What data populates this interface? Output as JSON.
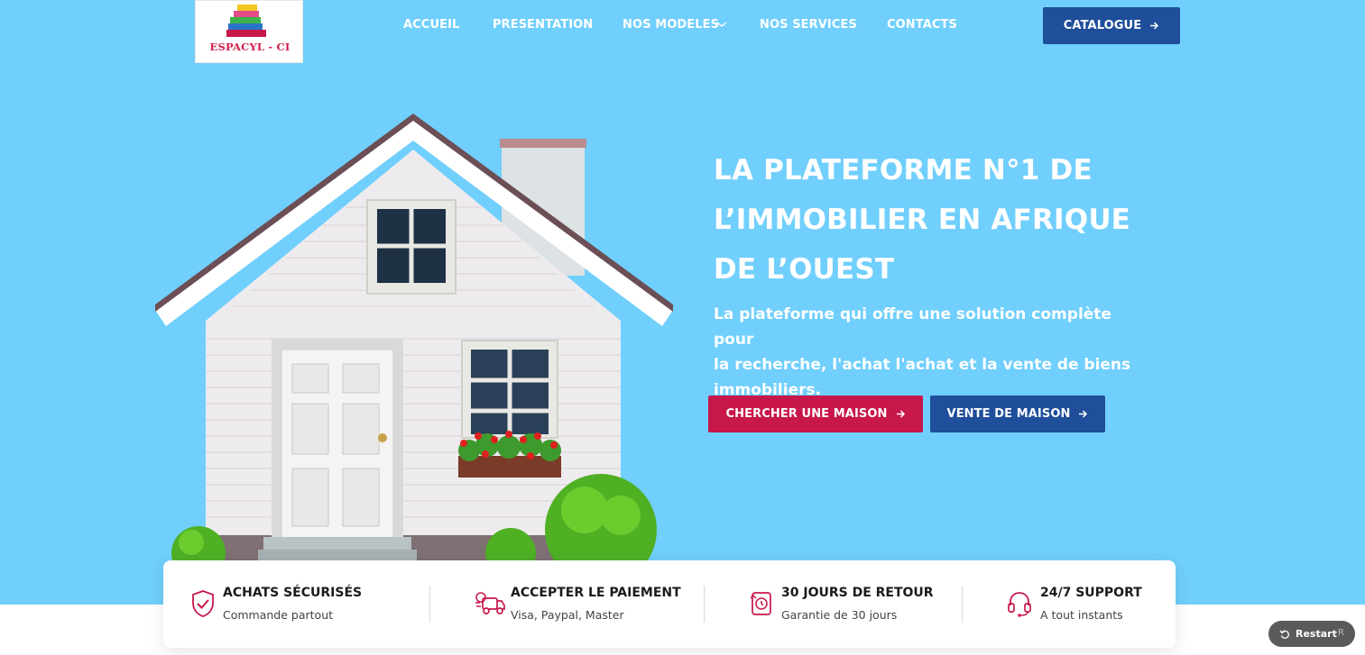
{
  "brand": {
    "name": "ESPACYL - CI"
  },
  "nav": {
    "items": [
      {
        "label": "ACCUEIL"
      },
      {
        "label": "PRESENTATION"
      },
      {
        "label": "NOS MODELES"
      },
      {
        "label": "NOS SERVICES"
      },
      {
        "label": "CONTACTS"
      }
    ],
    "cta_label": "CATALOGUE"
  },
  "hero": {
    "title_lines": [
      "LA PLATEFORME N°1 DE",
      "L’IMMOBILIER EN AFRIQUE",
      "DE L’OUEST"
    ],
    "subtitle_lines": [
      "La plateforme qui offre une solution complète pour",
      "la recherche, l'achat l'achat et la vente de biens",
      "immobiliers."
    ],
    "primary_button": "CHERCHER UNE MAISON",
    "secondary_button": "VENTE DE MAISON"
  },
  "features": [
    {
      "icon": "shield-check-icon",
      "title": "ACHATS SÉCURISÉS",
      "desc": "Commande partout"
    },
    {
      "icon": "delivery-icon",
      "title": "ACCEPTER LE PAIEMENT",
      "desc": "Visa, Paypal, Master"
    },
    {
      "icon": "return-icon",
      "title": "30 JOURS DE RETOUR",
      "desc": "Garantie de 30 jours"
    },
    {
      "icon": "headset-icon",
      "title": "24/7 SUPPORT",
      "desc": "A tout instants"
    }
  ],
  "restart": {
    "label": "Restart",
    "shortcut": "R"
  },
  "colors": {
    "hero_bg": "#70cffc",
    "primary_blue": "#1f4e9a",
    "accent_red": "#c8174a",
    "white": "#ffffff"
  }
}
